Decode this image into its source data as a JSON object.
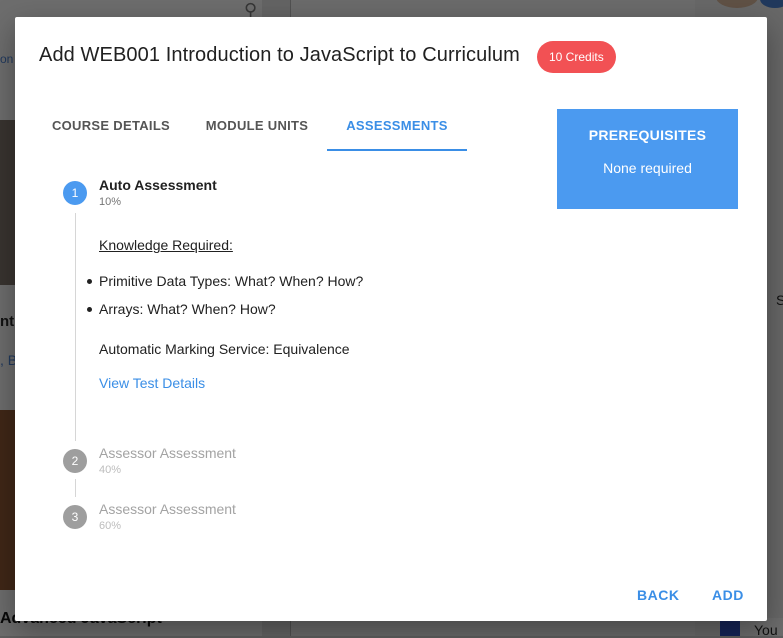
{
  "dialog": {
    "title": "Add WEB001 Introduction to JavaScript to Curriculum",
    "credits": "10 Credits",
    "tabs": [
      {
        "label": "COURSE DETAILS"
      },
      {
        "label": "MODULE UNITS"
      },
      {
        "label": "ASSESSMENTS",
        "active": true
      }
    ],
    "prerequisites": {
      "title": "PREREQUISITES",
      "value": "None required"
    },
    "steps": [
      {
        "number": "1",
        "title": "Auto Assessment",
        "weight": "10%",
        "active": true
      },
      {
        "number": "2",
        "title": "Assessor Assessment",
        "weight": "40%",
        "active": false
      },
      {
        "number": "3",
        "title": "Assessor Assessment",
        "weight": "60%",
        "active": false
      }
    ],
    "step1_detail": {
      "knowledge_label": "Knowledge Required:",
      "knowledge_items": [
        "Primitive Data Types: What? When? How?",
        "Arrays: What? When? How?"
      ],
      "marking_service": "Automatic Marking Service: Equivalence",
      "view_link": "View Test Details"
    },
    "actions": {
      "back": "BACK",
      "add": "ADD"
    }
  },
  "background": {
    "partial_texts": [
      "on",
      "nt",
      ", B",
      "S"
    ],
    "card_title": "Advanced JavaScript",
    "you_label": "You"
  },
  "colors": {
    "accent": "#3a8ee6",
    "prereq_bg": "#4b9af0",
    "credits_bg": "#f25154"
  }
}
